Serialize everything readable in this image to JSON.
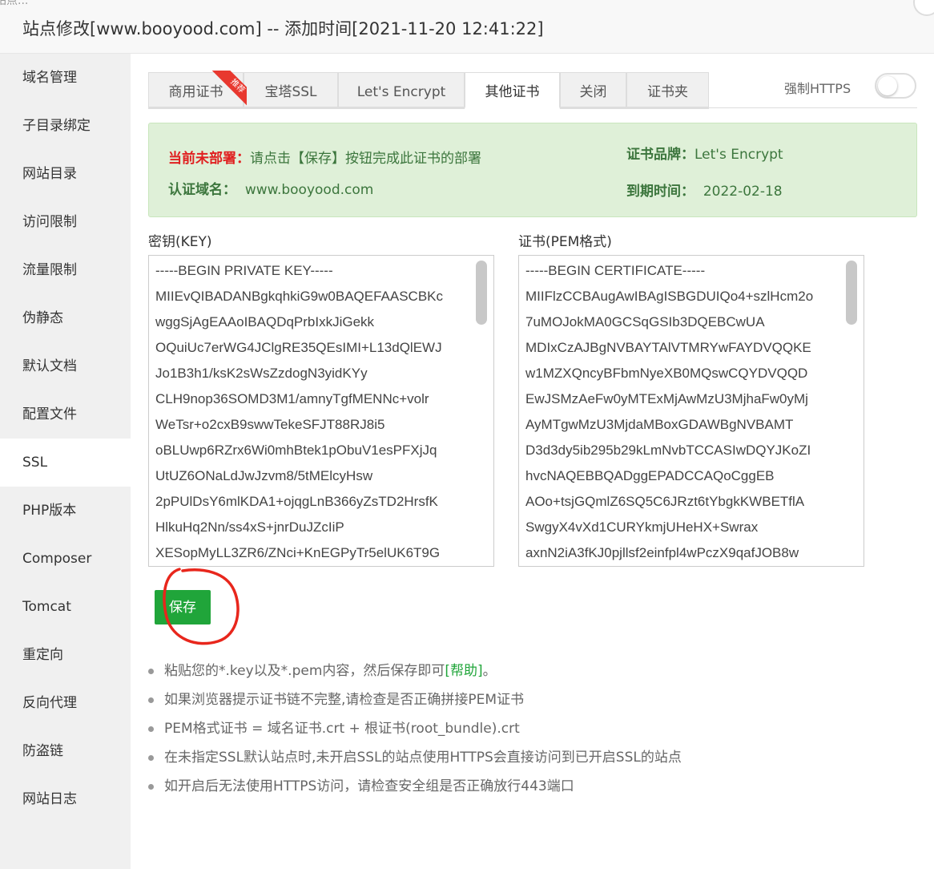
{
  "window": {
    "title": "站点修改[www.booyood.com] -- 添加时间[2021-11-20 12:41:22]",
    "corner_fragment": "站点..."
  },
  "sidebar": {
    "items": [
      {
        "label": "域名管理",
        "active": false
      },
      {
        "label": "子目录绑定",
        "active": false
      },
      {
        "label": "网站目录",
        "active": false
      },
      {
        "label": "访问限制",
        "active": false
      },
      {
        "label": "流量限制",
        "active": false
      },
      {
        "label": "伪静态",
        "active": false
      },
      {
        "label": "默认文档",
        "active": false
      },
      {
        "label": "配置文件",
        "active": false
      },
      {
        "label": "SSL",
        "active": true
      },
      {
        "label": "PHP版本",
        "active": false
      },
      {
        "label": "Composer",
        "active": false
      },
      {
        "label": "Tomcat",
        "active": false
      },
      {
        "label": "重定向",
        "active": false
      },
      {
        "label": "反向代理",
        "active": false
      },
      {
        "label": "防盗链",
        "active": false
      },
      {
        "label": "网站日志",
        "active": false
      }
    ]
  },
  "tabs": [
    {
      "label": "商用证书",
      "active": false
    },
    {
      "label": "宝塔SSL",
      "active": false
    },
    {
      "label": "Let's Encrypt",
      "active": false
    },
    {
      "label": "其他证书",
      "active": true
    },
    {
      "label": "关闭",
      "active": false
    },
    {
      "label": "证书夹",
      "active": false
    }
  ],
  "ribbon_badge": "推荐",
  "force_https": {
    "label": "强制HTTPS",
    "enabled": false
  },
  "status": {
    "deploy_label": "当前未部署：",
    "deploy_text": "请点击【保存】按钮完成此证书的部署",
    "domain_label": "认证域名：",
    "domain_value": "www.booyood.com",
    "brand_label": "证书品牌：",
    "brand_value": "Let's Encrypt",
    "expire_label": "到期时间：",
    "expire_value": "2022-02-18"
  },
  "key": {
    "label": "密钥(KEY)",
    "lines": [
      "-----BEGIN PRIVATE KEY-----",
      "MIIEvQIBADANBgkqhkiG9w0BAQEFAASCBKc",
      "wggSjAgEAAoIBAQDqPrbIxkJiGekk",
      "OQuiUc7erWG4JClgRE35QEsIMI+L13dQlEWJ",
      "Jo1B3h1/ksK2sWsZzdogN3yidKYy",
      "CLH9nop36SOMD3M1/amnyTgfMENNc+volr",
      "WeTsr+o2cxB9swwTekeSFJT88RJ8i5",
      "oBLUwp6RZrx6Wi0mhBtek1pObuV1esPFXjJq",
      "UtUZ6ONaLdJwJzvm8/5tMElcyHsw",
      "2pPUlDsY6mlKDA1+ojqgLnB366yZsTD2HrsfK",
      "HlkuHq2Nn/ss4xS+jnrDuJZcIiP",
      "XESopMyLL3ZR6/ZNci+KnEGPyTr5elUK6T9G"
    ]
  },
  "cert": {
    "label": "证书(PEM格式)",
    "lines": [
      "-----BEGIN CERTIFICATE-----",
      "MIIFlzCCBAugAwIBAgISBGDUIQo4+szlHcm2o",
      "7uMOJokMA0GCSqGSIb3DQEBCwUA",
      "MDIxCzAJBgNVBAYTAlVTMRYwFAYDVQQKE",
      "w1MZXQncyBFbmNyeXB0MQswCQYDVQQD",
      "EwJSMzAeFw0yMTExMjAwMzU3MjhaFw0yMj",
      "AyMTgwMzU3MjdaMBoxGDAWBgNVBAMT",
      "D3d3dy5ib295b29kLmNvbTCCASIwDQYJKoZI",
      "hvcNAQEBBQADggEPADCCAQoCggEB",
      "AOo+tsjGQmlZ6SQ5C6JRzt6tYbgkKWBETflA",
      "SwgyX4vXd1CURYkmjUHeHX+Swrax",
      "axnN2iA3fKJ0pjllsf2einfpl4wPczX9qafJOB8w"
    ]
  },
  "save_button": "保存",
  "notes": [
    {
      "text": "粘贴您的*.key以及*.pem内容，然后保存即可",
      "link": "[帮助]",
      "suffix": "。"
    },
    {
      "text": "如果浏览器提示证书链不完整,请检查是否正确拼接PEM证书"
    },
    {
      "text": "PEM格式证书 = 域名证书.crt + 根证书(root_bundle).crt"
    },
    {
      "text": "在未指定SSL默认站点时,未开启SSL的站点使用HTTPS会直接访问到已开启SSL的站点"
    },
    {
      "text": "如开启后无法使用HTTPS访问，请检查安全组是否正确放行443端口"
    }
  ],
  "colors": {
    "accent": "#20a53a",
    "alert_bg": "#dff0d8",
    "warn": "#e02020",
    "annotation": "#e8261c"
  }
}
